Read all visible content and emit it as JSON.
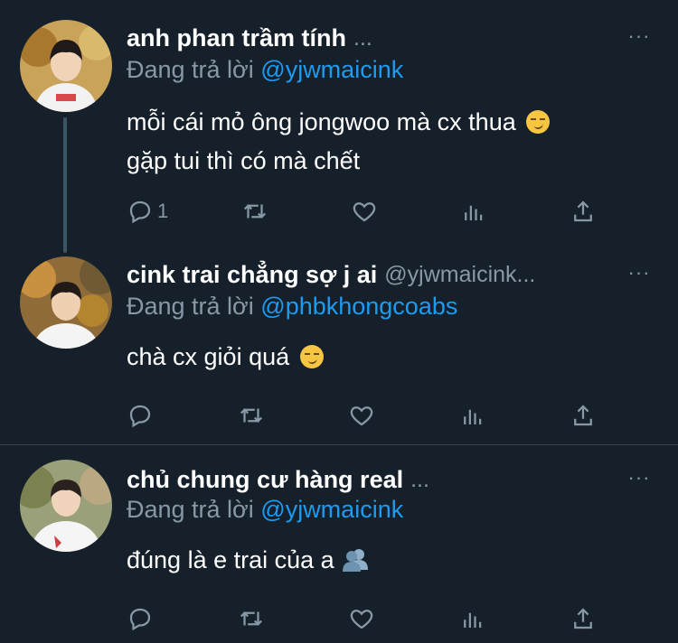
{
  "tweets": [
    {
      "name": "anh phan trầm tính",
      "handle": "...",
      "reply_prefix": "Đang trả lời",
      "reply_to": "@yjwmaicink",
      "text_lines": [
        "mỗi cái mỏ ông jongwoo mà cx thua",
        "gặp tui thì có mà chết"
      ],
      "emoji": "smirking-face",
      "actions": {
        "reply_count": "1",
        "retweet_count": "",
        "like_count": ""
      }
    },
    {
      "name": "cink trai chẳng sợ j ai",
      "handle": "@yjwmaicink...",
      "reply_prefix": "Đang trả lời",
      "reply_to": "@phbkhongcoabs",
      "text_lines": [
        "chà cx giỏi quá"
      ],
      "emoji": "smirking-face",
      "actions": {
        "reply_count": "",
        "retweet_count": "",
        "like_count": ""
      }
    },
    {
      "name": "chủ chung cư hàng real",
      "handle": "...",
      "reply_prefix": "Đang trả lời",
      "reply_to": "@yjwmaicink",
      "text_lines": [
        "đúng là e trai của a"
      ],
      "emoji": "busts-in-silhouette",
      "actions": {
        "reply_count": "",
        "retweet_count": "",
        "like_count": ""
      }
    }
  ],
  "more_icon": "···",
  "colors": {
    "background": "#15202b",
    "secondary_text": "#8899a6",
    "mention": "#1d9bf0",
    "divider": "#38444d"
  }
}
